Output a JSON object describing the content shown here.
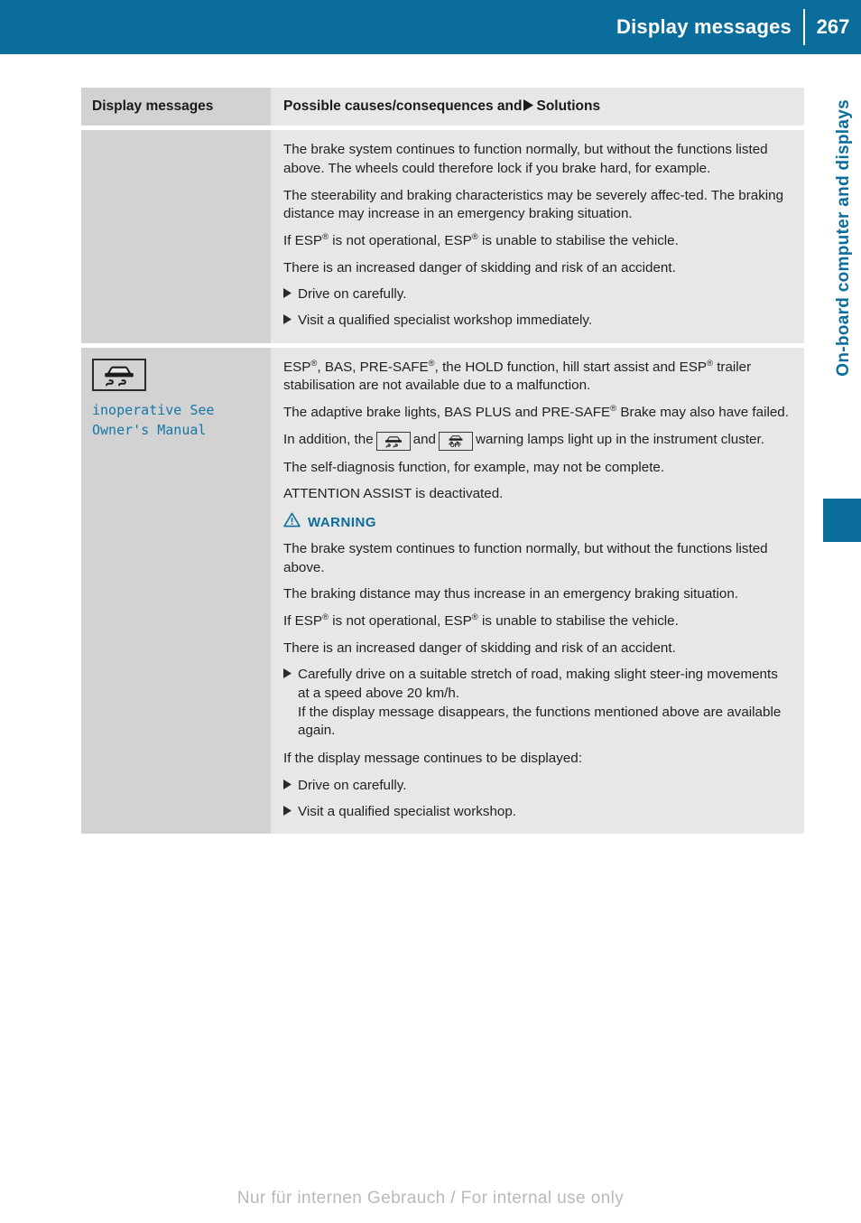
{
  "header": {
    "title": "Display messages",
    "page_number": "267",
    "accent_color": "#0b6d9c"
  },
  "side_tab": {
    "label": "On-board computer and displays",
    "color": "#0b6d9c"
  },
  "table": {
    "columns": {
      "left": "Display messages",
      "right_before_arrow": "Possible causes/consequences and",
      "right_after_arrow": "Solutions"
    },
    "rows": [
      {
        "message": {
          "icon": "",
          "code": ""
        },
        "blocks": [
          {
            "kind": "paragraph",
            "text": "The brake system continues to function normally, but without the functions listed above. The wheels could therefore lock if you brake hard, for example."
          },
          {
            "kind": "paragraph",
            "text": "The steerability and braking characteristics may be severely affec‐ted. The braking distance may increase in an emergency braking situation."
          },
          {
            "kind": "paragraph_esp",
            "pre": "If ESP",
            "mid": " is not operational, ESP",
            "post": " is unable to stabilise the vehicle."
          },
          {
            "kind": "paragraph",
            "text": "There is an increased danger of skidding and risk of an accident."
          },
          {
            "kind": "bullet",
            "text": "Drive on carefully."
          },
          {
            "kind": "bullet",
            "text": "Visit a qualified specialist workshop immediately."
          }
        ]
      },
      {
        "message": {
          "icon": "esp-skid-icon",
          "code": "inoperative See\nOwner's Manual"
        },
        "blocks": [
          {
            "kind": "paragraph_esp_list",
            "a": "ESP",
            "b": ", BAS, PRE-SAFE",
            "c": ", the HOLD function, hill start assist and ESP",
            "d": " trailer stabilisation are not available due to a malfunction."
          },
          {
            "kind": "paragraph_presafe",
            "pre": "The adaptive brake lights, BAS PLUS and PRE-SAFE",
            "post": " Brake may also have failed."
          },
          {
            "kind": "paragraph_lamps",
            "pre": "In addition, the",
            "mid": "and",
            "post": "warning lamps light up in the instrument cluster.",
            "icon_1": "esp-skid-lamp-icon",
            "icon_2": "esp-off-lamp-icon"
          },
          {
            "kind": "paragraph",
            "text": "The self‐diagnosis function, for example, may not be complete."
          },
          {
            "kind": "paragraph",
            "text": "ATTENTION ASSIST is deactivated."
          },
          {
            "kind": "warning_heading",
            "text": "WARNING"
          },
          {
            "kind": "paragraph",
            "text": "The brake system continues to function normally, but without the functions listed above."
          },
          {
            "kind": "paragraph",
            "text": "The braking distance may thus increase in an emergency braking situation."
          },
          {
            "kind": "paragraph_esp",
            "pre": "If ESP",
            "mid": " is not operational, ESP",
            "post": " is unable to stabilise the vehicle."
          },
          {
            "kind": "paragraph",
            "text": "There is an increased danger of skidding and risk of an accident."
          },
          {
            "kind": "bullet",
            "text": "Carefully drive on a suitable stretch of road, making slight steer‐ing movements at a speed above 20 km/h.\nIf the display message disappears, the functions mentioned above are available again."
          },
          {
            "kind": "paragraph",
            "text": "If the display message continues to be displayed:"
          },
          {
            "kind": "bullet",
            "text": "Drive on carefully."
          },
          {
            "kind": "bullet",
            "text": "Visit a qualified specialist workshop."
          }
        ]
      }
    ]
  },
  "footer": {
    "watermark": "Nur für internen Gebrauch / For internal use only"
  }
}
